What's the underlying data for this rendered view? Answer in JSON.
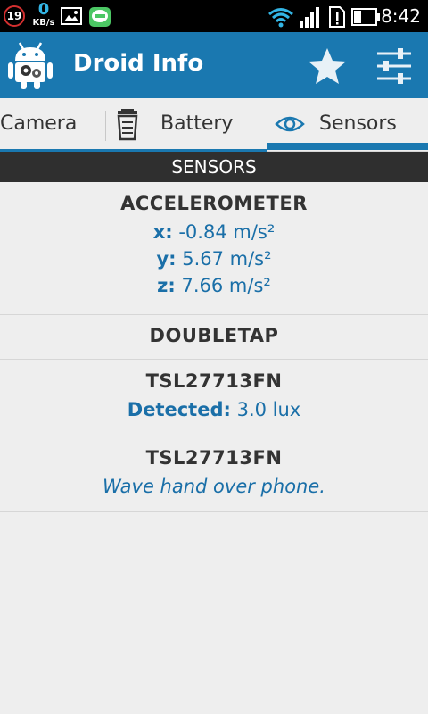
{
  "status_bar": {
    "notification_count": "19",
    "speed_value": "0",
    "speed_unit": "KB/s",
    "time": "8:42"
  },
  "action_bar": {
    "title": "Droid Info"
  },
  "tabs": [
    {
      "label": "Camera"
    },
    {
      "label": "Battery"
    },
    {
      "label": "Sensors"
    }
  ],
  "section": {
    "title": "SENSORS"
  },
  "sensors": {
    "accelerometer": {
      "name": "ACCELEROMETER",
      "x_label": "x:",
      "x_value": "-0.84 m/s²",
      "y_label": "y:",
      "y_value": "5.67 m/s²",
      "z_label": "z:",
      "z_value": "7.66 m/s²"
    },
    "doubletap": {
      "name": "DOUBLETAP"
    },
    "light": {
      "name": "TSL27713FN",
      "detected_label": "Detected:",
      "detected_value": "3.0 lux"
    },
    "proximity": {
      "name": "TSL27713FN",
      "note": "Wave hand over phone."
    }
  },
  "colors": {
    "accent": "#1a78b0",
    "header_dark": "#2f2f2f",
    "value_blue": "#1a6fa8"
  }
}
